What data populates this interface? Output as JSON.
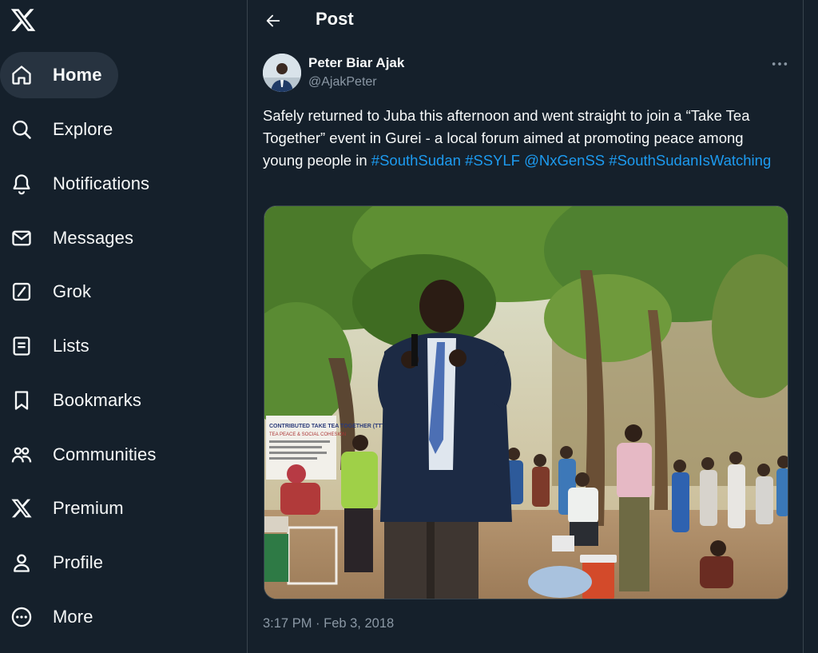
{
  "sidebar": {
    "logo_icon": "x-logo-icon",
    "items": [
      {
        "label": "Home",
        "icon": "home-icon",
        "active": true
      },
      {
        "label": "Explore",
        "icon": "search-icon"
      },
      {
        "label": "Notifications",
        "icon": "bell-icon"
      },
      {
        "label": "Messages",
        "icon": "mail-icon"
      },
      {
        "label": "Grok",
        "icon": "grok-icon"
      },
      {
        "label": "Lists",
        "icon": "list-icon"
      },
      {
        "label": "Bookmarks",
        "icon": "bookmark-icon"
      },
      {
        "label": "Communities",
        "icon": "people-icon"
      },
      {
        "label": "Premium",
        "icon": "x-logo-icon"
      },
      {
        "label": "Profile",
        "icon": "person-icon"
      },
      {
        "label": "More",
        "icon": "more-circle-icon"
      }
    ]
  },
  "header": {
    "title": "Post"
  },
  "post": {
    "author_name": "Peter Biar Ajak",
    "author_handle": "@AjakPeter",
    "text_part1": "Safely returned to Juba this afternoon and went straight to join a “Take Tea Together” event in Gurei - a local forum aimed at promoting peace among young people in ",
    "links": [
      "#SouthSudan",
      "#SSYLF",
      "@NxGenSS",
      "#SouthSudanIsWatching"
    ],
    "banner_text": [
      "CONTRIBUTED TAKE TEA TOGETHER (TTT)",
      "TEA PEACE & SOCIAL COHESION"
    ],
    "timestamp": "3:17 PM · Feb 3, 2018"
  },
  "colors": {
    "background": "#15202b",
    "link": "#1d9bf0",
    "muted": "#8b98a5",
    "border": "#38444d",
    "active_nav": "#273340"
  }
}
